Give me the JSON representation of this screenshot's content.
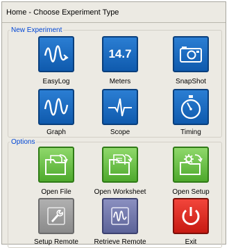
{
  "header": {
    "title": "Home - Choose Experiment Type"
  },
  "groups": {
    "new_experiment": {
      "legend": "New Experiment",
      "items": [
        {
          "label": "EasyLog",
          "icon": "easylog-wave-icon"
        },
        {
          "label": "Meters",
          "icon": "meters-readout-icon",
          "readout": "14.7"
        },
        {
          "label": "SnapShot",
          "icon": "camera-icon"
        },
        {
          "label": "Graph",
          "icon": "graph-wave-icon"
        },
        {
          "label": "Scope",
          "icon": "scope-pulse-icon"
        },
        {
          "label": "Timing",
          "icon": "stopwatch-icon"
        }
      ]
    },
    "options": {
      "legend": "Options",
      "items": [
        {
          "label": "Open File",
          "icon": "open-file-icon"
        },
        {
          "label": "Open Worksheet",
          "icon": "open-worksheet-icon"
        },
        {
          "label": "Open Setup",
          "icon": "open-setup-icon"
        },
        {
          "label": "Setup Remote",
          "icon": "wrench-icon"
        },
        {
          "label": "Retrieve Remote",
          "icon": "retrieve-remote-icon"
        },
        {
          "label": "Exit",
          "icon": "power-icon"
        }
      ]
    }
  },
  "colors": {
    "legend_text": "#0046d5",
    "tile_blue": "#1565c0",
    "tile_green": "#6cc24a",
    "tile_grey": "#9a9a9a",
    "tile_slate": "#6d72a8",
    "tile_red": "#e0271f"
  }
}
